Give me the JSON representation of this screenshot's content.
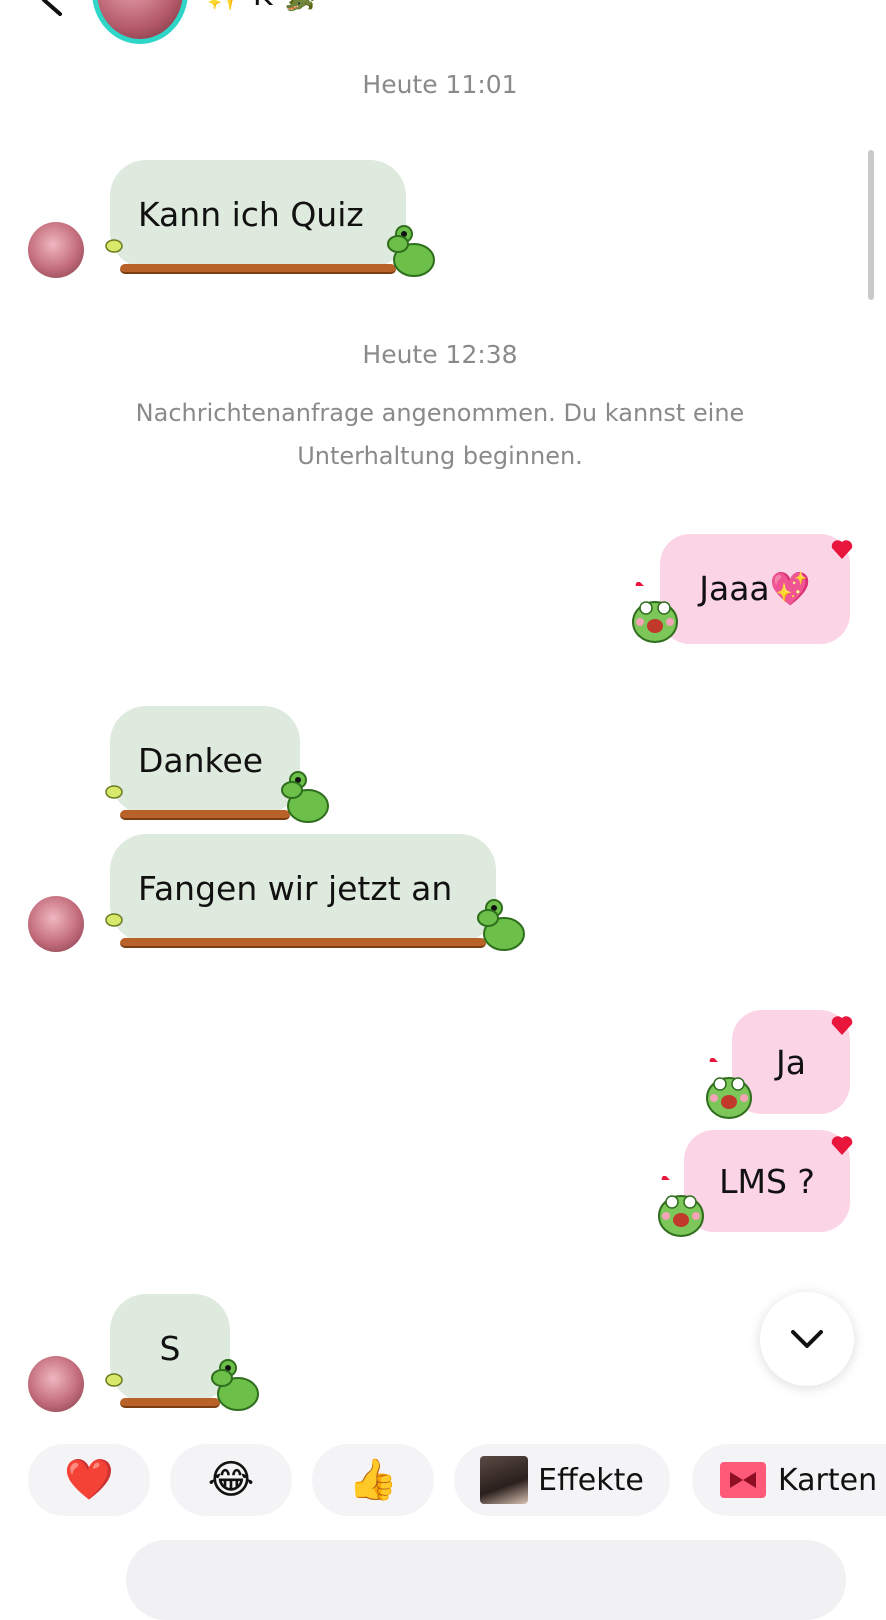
{
  "header": {
    "name": "✨ K 🐊",
    "back_icon": "chevron-left-icon",
    "more_icon": "more-horizontal-icon"
  },
  "conversation": {
    "timestamp_1": "Heute 11:01",
    "timestamp_2": "Heute 12:38",
    "system_message_line1": "Nachrichtenanfrage angenommen. Du kannst eine",
    "system_message_line2": "Unterhaltung beginnen.",
    "messages": [
      {
        "from": "them",
        "text": "Kann ich Quiz"
      },
      {
        "from": "me",
        "text": "Jaaa💖",
        "reaction": "heart"
      },
      {
        "from": "them",
        "text": "Dankee"
      },
      {
        "from": "them",
        "text": "Fangen wir jetzt an"
      },
      {
        "from": "me",
        "text": "Ja",
        "reaction": "heart"
      },
      {
        "from": "me",
        "text": "LMS ?",
        "reaction": "heart"
      },
      {
        "from": "them",
        "text": "S"
      }
    ]
  },
  "quick_reactions": {
    "heart": "❤️",
    "laugh": "😂",
    "thumbs_up": "👍",
    "effects_label": "Effekte",
    "cards_label": "Karten"
  },
  "colors": {
    "incoming_bubble": "#dfeade",
    "outgoing_bubble": "#fbd4e6",
    "tongue": "#b8622a",
    "frog_green": "#6cc04a",
    "heart_red": "#e8163c",
    "story_ring": "#2fd6c8"
  }
}
